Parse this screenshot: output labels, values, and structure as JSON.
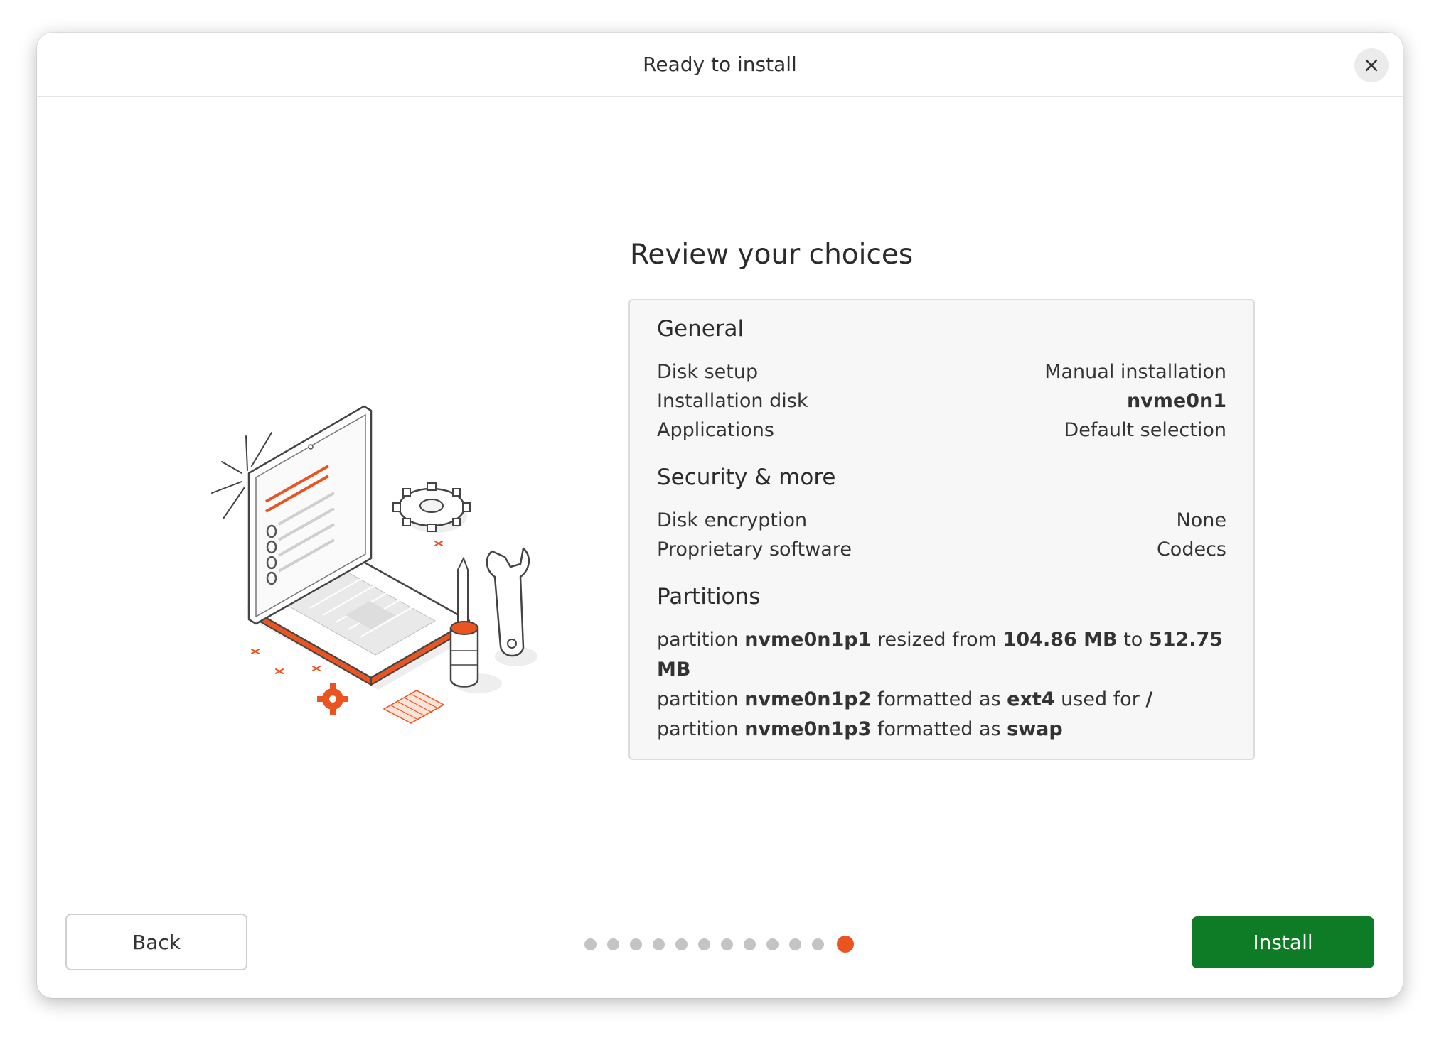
{
  "window": {
    "title": "Ready to install"
  },
  "main": {
    "heading": "Review your choices",
    "general": {
      "title": "General",
      "rows": [
        {
          "label": "Disk setup",
          "value": "Manual installation"
        },
        {
          "label": "Installation disk",
          "value": "nvme0n1"
        },
        {
          "label": "Applications",
          "value": "Default selection"
        }
      ]
    },
    "security": {
      "title": "Security & more",
      "rows": [
        {
          "label": "Disk encryption",
          "value": "None"
        },
        {
          "label": "Proprietary software",
          "value": "Codecs"
        }
      ]
    },
    "partitions": {
      "title": "Partitions",
      "items": [
        {
          "t1": "partition ",
          "b1": "nvme0n1p1",
          "t2": " resized from ",
          "b2": "104.86 MB",
          "t3": " to ",
          "b3": "512.75 MB"
        },
        {
          "t1": "partition ",
          "b1": "nvme0n1p2",
          "t2": " formatted as ",
          "b2": "ext4",
          "t3": " used for ",
          "b3": "/"
        },
        {
          "t1": "partition ",
          "b1": "nvme0n1p3",
          "t2": " formatted as ",
          "b2": "swap",
          "t3": "",
          "b3": ""
        }
      ]
    }
  },
  "footer": {
    "back_label": "Back",
    "install_label": "Install",
    "steps_total": 12,
    "steps_current": 12
  },
  "colors": {
    "accent": "#e95420",
    "install_button": "#0e7c26",
    "dot_inactive": "#c4c4c4"
  },
  "icons": {
    "close": "close-icon",
    "illustration": "laptop-tools-illustration"
  }
}
